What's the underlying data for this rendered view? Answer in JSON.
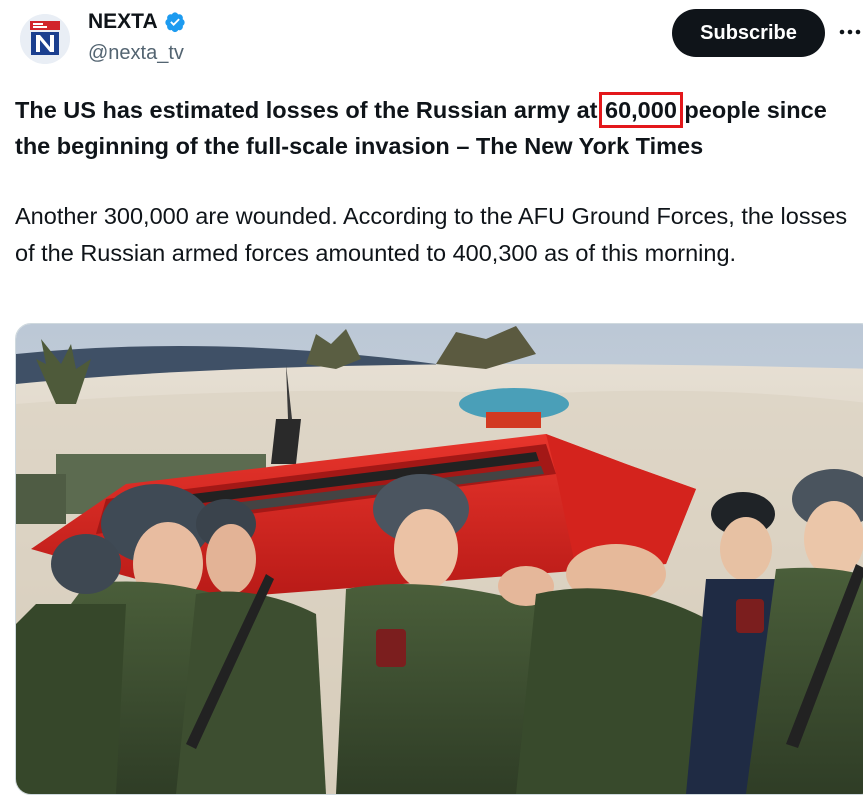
{
  "author": {
    "name": "NEXTA",
    "handle": "@nexta_tv",
    "avatar_letter": "N",
    "verified_color": "#1d9bf0"
  },
  "actions": {
    "subscribe_label": "Subscribe",
    "more_icon": "more-horizontal-icon"
  },
  "tweet": {
    "headline_pre": "The US has estimated losses of the Russian army at ",
    "headline_highlight": "60,000",
    "headline_post": " people since the beginning of the full-scale invasion – The New York Times",
    "body": "Another 300,000 are wounded. According to the AFU Ground Forces, the losses of the Russian armed forces amounted to 400,300 as of this morning."
  },
  "colors": {
    "highlight_box": "#e3171b",
    "button_bg": "#0f1419",
    "handle": "#536471",
    "coffin": "#d9231f"
  }
}
